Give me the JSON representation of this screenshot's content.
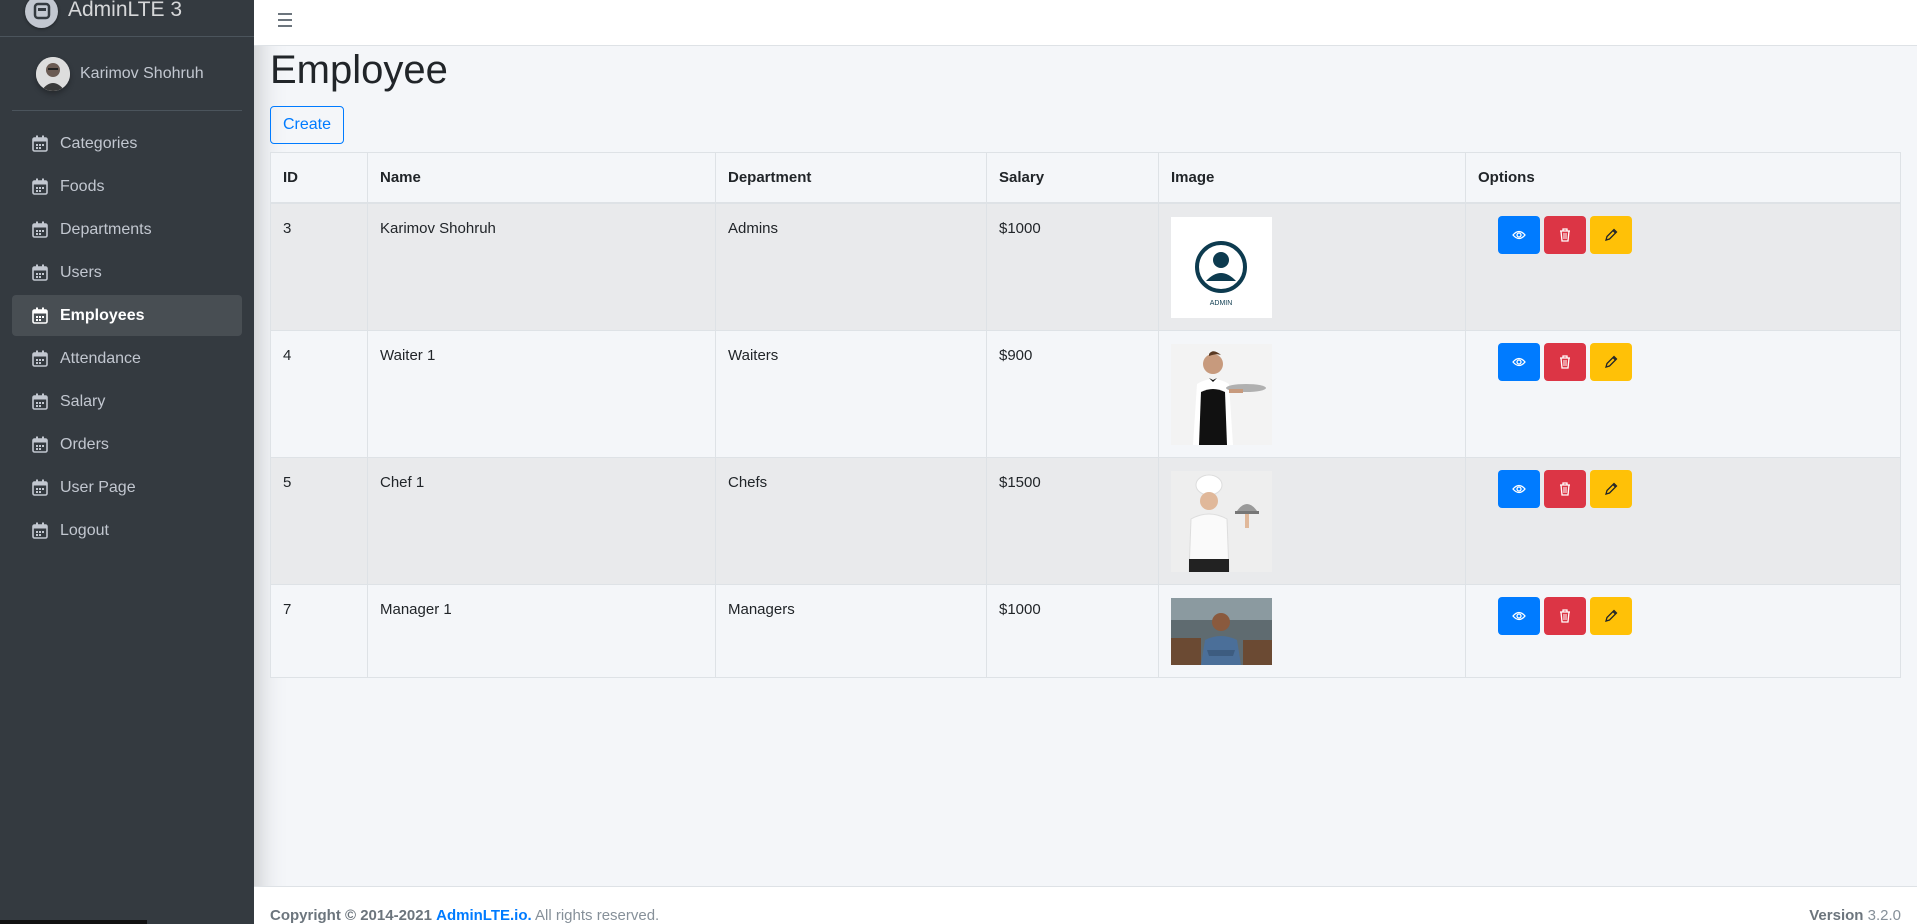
{
  "brand": {
    "title": "AdminLTE 3"
  },
  "user": {
    "name": "Karimov Shohruh"
  },
  "sidebar": {
    "items": [
      {
        "label": "Categories"
      },
      {
        "label": "Foods"
      },
      {
        "label": "Departments"
      },
      {
        "label": "Users"
      },
      {
        "label": "Employees",
        "active": true
      },
      {
        "label": "Attendance"
      },
      {
        "label": "Salary"
      },
      {
        "label": "Orders"
      },
      {
        "label": "User Page"
      },
      {
        "label": "Logout"
      }
    ]
  },
  "page": {
    "title": "Employee",
    "create_label": "Create"
  },
  "table": {
    "headers": [
      "ID",
      "Name",
      "Department",
      "Salary",
      "Image",
      "Options"
    ],
    "rows": [
      {
        "id": "3",
        "name": "Karimov Shohruh",
        "department": "Admins",
        "salary": "$1000",
        "image": "admin-avatar",
        "image_text": "ADMIN"
      },
      {
        "id": "4",
        "name": "Waiter 1",
        "department": "Waiters",
        "salary": "$900",
        "image": "waiter-photo"
      },
      {
        "id": "5",
        "name": "Chef 1",
        "department": "Chefs",
        "salary": "$1500",
        "image": "chef-photo"
      },
      {
        "id": "7",
        "name": "Manager 1",
        "department": "Managers",
        "salary": "$1000",
        "image": "manager-photo"
      }
    ]
  },
  "footer": {
    "copyright": "Copyright © 2014-2021",
    "link": "AdminLTE.io.",
    "rights": "All rights reserved.",
    "version_label": "Version",
    "version": "3.2.0"
  },
  "colors": {
    "primary": "#007bff",
    "danger": "#dc3545",
    "warning": "#ffc107",
    "sidebar": "#343a40"
  }
}
